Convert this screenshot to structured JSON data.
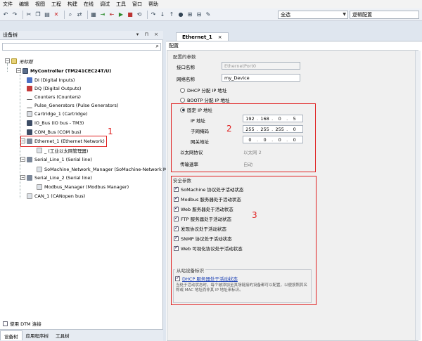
{
  "menu": [
    "文件",
    "编辑",
    "视图",
    "工程",
    "构建",
    "在线",
    "调试",
    "工具",
    "窗口",
    "帮助"
  ],
  "toolbar": {
    "config_select": "全选",
    "logic_config": "逻辑配置"
  },
  "left_panel": {
    "title": "设备树",
    "title_controls": "▾ ⊓ ×",
    "search_placeholder": "",
    "tree": {
      "root": "无标题",
      "controller": "MyController (TM241CEC24T/U)",
      "items": [
        "DI (Digital Inputs)",
        "DQ (Digital Outputs)",
        "Counters (Counters)",
        "Pulse_Generators (Pulse Generators)",
        "Cartridge_1 (Cartridge)",
        "IO_Bus (IO bus - TM3)",
        "COM_Bus (COM bus)",
        "Ethernet_1 (Ethernet Network)",
        "_ (工业以太网管理器)",
        "Serial_Line_1 (Serial line)",
        "SoMachine_Network_Manager (SoMachine-Network Manag",
        "Serial_Line_2 (Serial line)",
        "Modbus_Manager (Modbus Manager)",
        "CAN_1 (CANopen bus)"
      ]
    },
    "dtm_label": "使用 DTM 连接",
    "bottom_tabs": [
      "设备树",
      "应用程序树",
      "工具树"
    ]
  },
  "doc": {
    "tab_label": "Ethernet_1",
    "tab_close": "×",
    "subtab": "配置",
    "configured_params": "配置的参数",
    "interface_name_label": "接口名称",
    "interface_name_value": "EthernetPort0",
    "network_name_label": "网络名称",
    "network_name_value": "my_Device",
    "dhcp_label": "DHCP 分配 IP 地址",
    "bootp_label": "BOOTP 分配 IP 地址",
    "fixed_ip_label": "固定 IP 地址",
    "ip_label": "IP 地址",
    "ip_value": [
      "192",
      "168",
      "0",
      "5"
    ],
    "mask_label": "子网掩码",
    "mask_value": [
      "255",
      "255",
      "255",
      "0"
    ],
    "gateway_label": "网关地址",
    "gateway_value": [
      "0",
      "0",
      "0",
      "0"
    ],
    "eth_protocol_label": "以太网协议",
    "eth_protocol_value": "以太网 2",
    "speed_label": "传输速率",
    "speed_value": "自动",
    "security_title": "安全参数",
    "security_items": [
      "SoMachine 协议处于活动状态",
      "Modbus 服务器处于活动状态",
      "Web 服务器处于活动状态",
      "FTP 服务器处于活动状态",
      "发现协议处于活动状态",
      "SNMP 协议处于活动状态",
      "Web 可视化协议处于活动状态"
    ],
    "slave_title": "从站设备标识",
    "slave_dhcp": "DHCP 服务器处于活动状态",
    "slave_note": "当处于活动状态时，每个被添加至其场链接的设备都可以配置，以便按照其名称或 MAC 地址而非其 IP 地址来标识。"
  },
  "annotations": [
    "1",
    "2",
    "3"
  ],
  "colors": {
    "annotation_red": "#e02020",
    "link_blue": "#1a3fb4"
  }
}
